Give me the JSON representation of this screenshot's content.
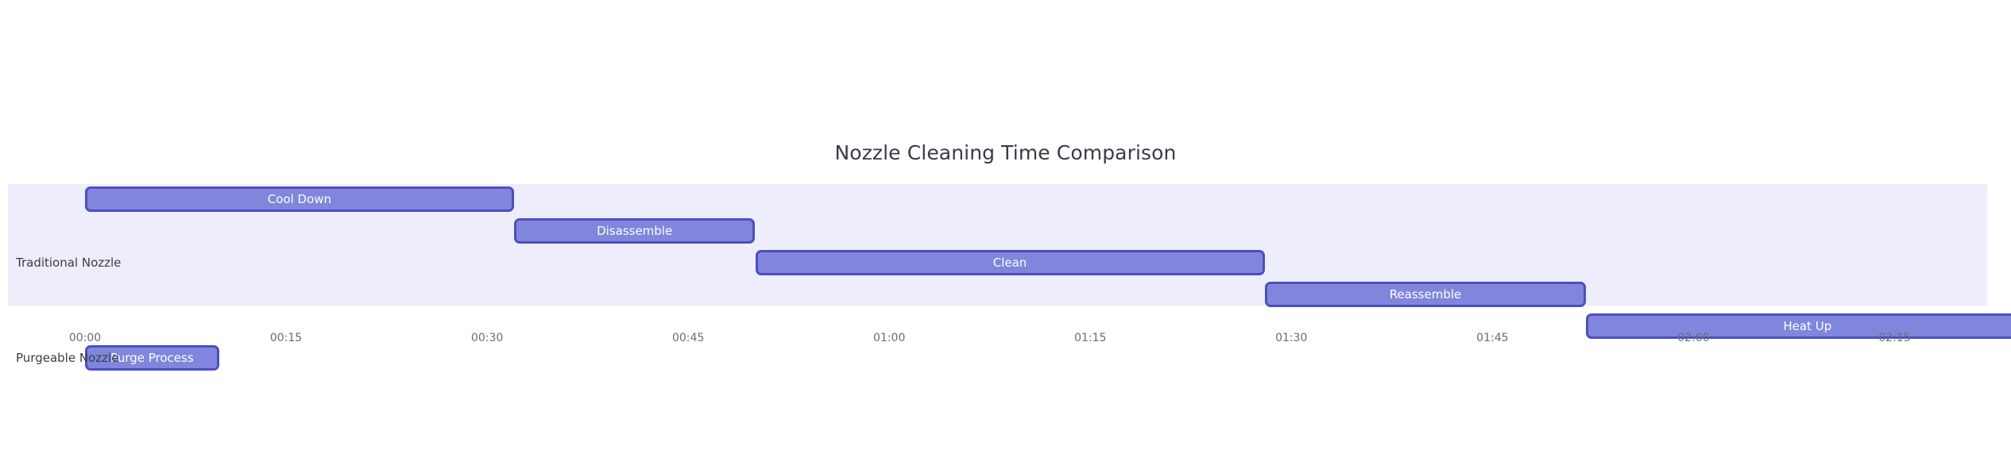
{
  "chart_data": {
    "type": "bar",
    "subtype": "gantt",
    "title": "Nozzle Cleaning Time Comparison",
    "xlabel": "",
    "ylabel": "",
    "orientation": "horizontal",
    "grid": false,
    "legend": "none",
    "time_unit": "minutes",
    "xlim": [
      0,
      145
    ],
    "x_tick_labels": [
      "00:00",
      "00:15",
      "00:30",
      "00:45",
      "01:00",
      "01:15",
      "01:30",
      "01:45",
      "02:00",
      "02:15"
    ],
    "x_tick_values": [
      0,
      15,
      30,
      45,
      60,
      75,
      90,
      105,
      120,
      135
    ],
    "categories": [
      "Traditional Nozzle",
      "Purgeable Nozzle"
    ],
    "series": [
      {
        "name": "Traditional Nozzle",
        "tasks": [
          {
            "label": "Cool Down",
            "start": 0,
            "end": 32,
            "duration": 32
          },
          {
            "label": "Disassemble",
            "start": 32,
            "end": 50,
            "duration": 18
          },
          {
            "label": "Clean",
            "start": 50,
            "end": 88,
            "duration": 38
          },
          {
            "label": "Reassemble",
            "start": 88,
            "end": 112,
            "duration": 24
          },
          {
            "label": "Heat Up",
            "start": 112,
            "end": 145,
            "duration": 33
          }
        ]
      },
      {
        "name": "Purgeable Nozzle",
        "tasks": [
          {
            "label": "Purge Process",
            "start": 0,
            "end": 10,
            "duration": 10
          }
        ]
      }
    ],
    "colors": {
      "bar_fill": "#8086dc",
      "bar_border": "#4e4ec2",
      "bar_label": "#ffffff",
      "row_band": "#eeedfb",
      "title": "#3a3a48",
      "axis_text": "#6b6b75",
      "category_text": "#3c3c46",
      "background": "#ffffff"
    }
  },
  "chart": {
    "title": "Nozzle Cleaning Time Comparison"
  },
  "y_axis": {
    "labels": [
      {
        "text": "Traditional Nozzle"
      },
      {
        "text": "Purgeable Nozzle"
      }
    ]
  },
  "x_axis": {
    "ticks": [
      {
        "label": "00:00"
      },
      {
        "label": "00:15"
      },
      {
        "label": "00:30"
      },
      {
        "label": "00:45"
      },
      {
        "label": "01:00"
      },
      {
        "label": "01:15"
      },
      {
        "label": "01:30"
      },
      {
        "label": "01:45"
      },
      {
        "label": "02:00"
      },
      {
        "label": "02:15"
      }
    ]
  },
  "bars": [
    {
      "label": "Cool Down"
    },
    {
      "label": "Disassemble"
    },
    {
      "label": "Clean"
    },
    {
      "label": "Reassemble"
    },
    {
      "label": "Heat Up"
    },
    {
      "label": "Purge Process"
    }
  ]
}
